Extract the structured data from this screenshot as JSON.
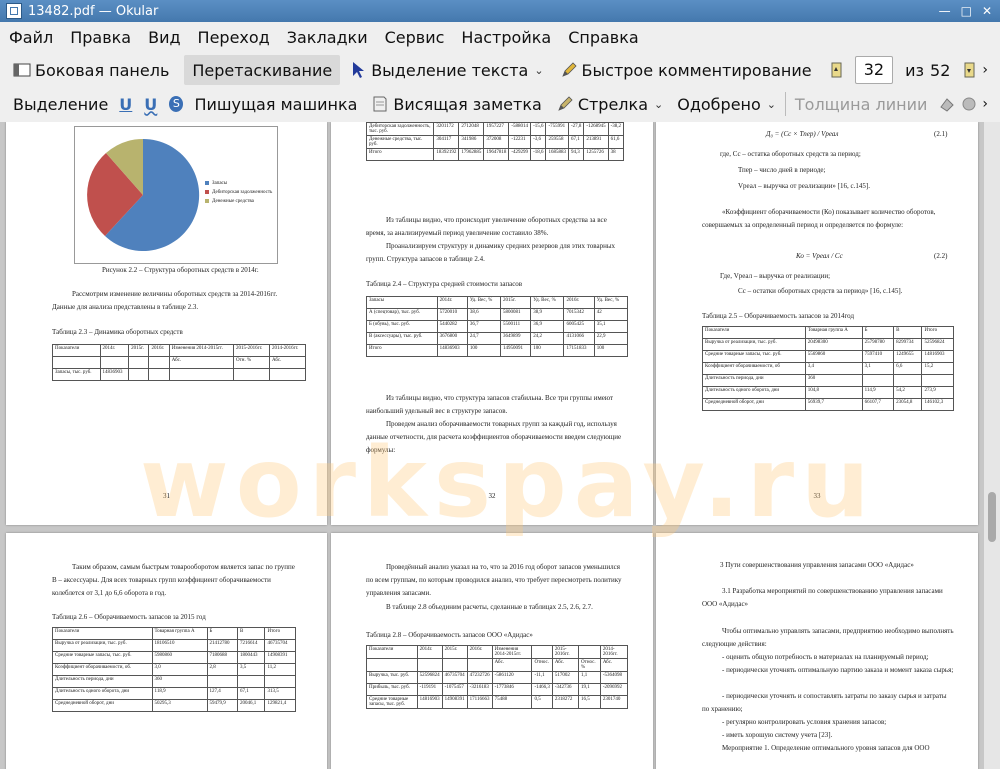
{
  "window": {
    "title": "13482.pdf — Okular"
  },
  "menu": [
    "Файл",
    "Правка",
    "Вид",
    "Переход",
    "Закладки",
    "Сервис",
    "Настройка",
    "Справка"
  ],
  "toolbar1": {
    "sidebar": "Боковая панель",
    "drag": "Перетаскивание",
    "text_select": "Выделение текста",
    "quick_comment": "Быстрое комментирование",
    "page_current": "32",
    "of": "из",
    "page_total": "52"
  },
  "toolbar2": {
    "highlight": "Выделение",
    "typewriter": "Пишущая машинка",
    "popup_note": "Висящая заметка",
    "arrow": "Стрелка",
    "approved": "Одобрено",
    "line_width": "Толщина линии"
  },
  "colors": {
    "titlebar": "#4d82b8",
    "pie_blue": "#4f81bd",
    "pie_red": "#c0504d",
    "pie_olive": "#b8b36e"
  },
  "watermark": "workspay.ru",
  "p1": {
    "legend": [
      "Запасы",
      "Дебиторская задолженность",
      "Денежные средства"
    ],
    "caption": "Рисунок 2.2 – Структура оборотных средств в 2014г.",
    "para": "Рассмотрим изменение величины оборотных средств за 2014-2016гг. Данные для анализа представлены в таблице 2.3.",
    "table_title": "Таблица 2.3 – Динамика оборотных средств",
    "table": [
      [
        "Показатели",
        "2014г.",
        "2015г.",
        "2016г.",
        "Изменения 2014-2015гг.",
        "2015-2016гг.",
        "2014-2016гг."
      ],
      [
        "",
        "",
        "",
        "",
        "Абс.",
        "Отн. %",
        "Абс."
      ],
      [
        "Запасы, тыс. руб.",
        "14836903",
        "",
        "",
        "",
        "",
        ""
      ]
    ],
    "page_num": "31"
  },
  "p2": {
    "top_table": [
      [
        "Дебиторская задолженность, тыс. руб.",
        "3201172",
        "2712048",
        "1957227",
        "-588014",
        "-15,6",
        "-755991",
        "-27,8",
        "-1268945",
        "-38,2"
      ],
      [
        "Денежные средства, тыс. руб.",
        "304117",
        "341986",
        "372008",
        "-12231",
        "-3,6",
        "259558",
        "67,1",
        "213891",
        "61,6"
      ],
      [
        "Итого",
        "18392192",
        "17962885",
        "19647818",
        "-429299",
        "-18,6",
        "1685883",
        "94,3",
        "1255726",
        "38"
      ]
    ],
    "para1": "Из таблицы видно, что происходит увеличение оборотных средства за все время, за анализируемый период увеличение составило 38%.",
    "para2": "Проанализируем структуру и динамику средних резервов для этих товарных групп. Структура запасов в таблице 2.4.",
    "table_title": "Таблица 2.4 – Структура средней стоимости запасов",
    "table": [
      [
        "Запасы",
        "2014г.",
        "Уд. Вес, %",
        "2015г.",
        "Уд. Вес, %",
        "2016г.",
        "Уд. Вес, %"
      ],
      [
        "А (спецтовар), тыс. руб.",
        "5720010",
        "38,6",
        "5800081",
        "38,9",
        "7015342",
        "42"
      ],
      [
        "Б (обувь), тыс. руб.",
        "5440282",
        "36,7",
        "5500111",
        "36,9",
        "6005425",
        "35,1"
      ],
      [
        "В (аксессуары), тыс. руб.",
        "3676800",
        "24,7",
        "3649899",
        "24,2",
        "4131066",
        "22,9"
      ],
      [
        "Итого",
        "14836903",
        "100",
        "14950091",
        "100",
        "17151833",
        "100"
      ]
    ],
    "para3": "Из таблицы видно, что структура запасов стабильна. Все три группы имеют наибольший удельный вес в структуре запасов.",
    "para4": "Проведем анализ оборачиваемости товарных групп за каждый год, используя данные отчетности, для расчета коэффициентов оборачиваемости введем следующие формулы:",
    "page_num": "32"
  },
  "p3": {
    "formula1": "Д₀ = (Сс × Тпер) / Vреал",
    "num1": "(2.1)",
    "def1": "где, Сс – остатка оборотных средств за период;",
    "def2": "Тпер – число дней в периоде;",
    "def3": "Vреал – выручка от реализации» [16, с.145].",
    "para1": "«Коэффициент оборачиваемости (Ко) показывает количество оборотов, совершаемых за определенный период и определяется по формуле:",
    "formula2": "Ко = Vреал / Сс",
    "num2": "(2.2)",
    "def4": "Где, Vреал – выручка от реализации;",
    "def5": "Сс – остатки оборотных средств за период» [16, с.145].",
    "table_title": "Таблица 2.5 – Оборачиваемость запасов за 2014год",
    "table": [
      [
        "Показатели",
        "Товарная группа А",
        "Б",
        "В",
        "Итого"
      ],
      [
        "Выручка от реализации, тыс. руб.",
        "20498300",
        "25798780",
        "8299734",
        "52596824"
      ],
      [
        "Средние товарные запасы, тыс. руб.",
        "5569860",
        "7597410",
        "1249655",
        "14816903"
      ],
      [
        "Коэффициент оборачиваемости, об",
        "3,4",
        "3,1",
        "6,6",
        "15,2"
      ],
      [
        "Длительность периода, дни",
        "360",
        "",
        "",
        ""
      ],
      [
        "Длительность одного оборота, дни",
        "104,8",
        "114,9",
        "54,2",
        "273,9"
      ],
      [
        "Среднедневной оборот, дни",
        "56939,7",
        "66107,7",
        "23054,8",
        "146102,3"
      ]
    ],
    "page_num": "33"
  },
  "p4": {
    "para": "Таким образом, самым быстрым товарооборотом является запас по группе В – аксессуары. Для всех товарных групп коэффициент оборачиваемости колеблется от 3,1 до 6,6 оборота в год.",
    "table_title": "Таблица 2.6 – Оборачиваемость запасов за 2015 год",
    "table": [
      [
        "Показатели",
        "Товарная группа А",
        "Б",
        "В",
        "Итого"
      ],
      [
        "Выручка от реализации, тыс. руб.",
        "18106510",
        "21412780",
        "7216614",
        "46735704"
      ],
      [
        "Средние товарные запасы, тыс. руб.",
        "5980860",
        "7180688",
        "1800443",
        "14908391"
      ],
      [
        "Коэффициент оборачиваемости, об.",
        "3,0",
        "2,8",
        "3,5",
        "11,2"
      ],
      [
        "Длительность периода, дни",
        "360",
        "",
        "",
        ""
      ],
      [
        "Длительность одного оборота, дни",
        "118,9",
        "127,4",
        "67,1",
        "313,5"
      ],
      [
        "Среднедневной оборот, дни",
        "50295,3",
        "59479,9",
        "20046,1",
        "129821,4"
      ]
    ]
  },
  "p5": {
    "para1": "Проведённый анализ указал на то, что за 2016 год оборот запасов уменьшился по всем группам, по которым проводился анализ, что требует пересмотреть политику управления запасами.",
    "para2": "В таблице 2.8 объединим расчеты, сделанные в таблицах 2.5, 2.6, 2.7.",
    "table_title": "Таблица 2.8 – Оборачиваемость запасов ООО «Адидас»",
    "table": [
      [
        "Показатели",
        "2014г.",
        "2015г.",
        "2016г.",
        "Изменения 2014-2015гг.",
        "",
        "2015-2016гг.",
        "",
        "2014-2016гг."
      ],
      [
        "",
        "",
        "",
        "",
        "Абс.",
        "Относ.",
        "Абс.",
        "Относ. %",
        "Абс."
      ],
      [
        "Выручка, тыс. руб.",
        "52596824",
        "46735704",
        "47232726",
        "-5861120",
        "-11,1",
        "517002",
        "1,1",
        "-5364098",
        "-10,1"
      ],
      [
        "Прибыль, тыс. руб.",
        "-119191",
        "-1075457",
        "-3216183",
        "-1773846",
        "-1466,3",
        "-342736",
        "19,1",
        "-2096992",
        "1753,1"
      ],
      [
        "Средние товарные запасы, тыс. руб.",
        "14816903",
        "14908391",
        "17116663",
        "75488",
        "0,5",
        "2318272",
        "16,5",
        "2301740",
        "15,5"
      ]
    ]
  },
  "p6": {
    "heading": "3 Пути совершенствования управления запасами ООО «Адидас»",
    "sub": "3.1 Разработка мероприятий по совершенствованию управления запасами ООО «Адидас»",
    "para1": "Чтобы оптимально управлять запасами, предприятию необходимо выполнять следующие действия:",
    "items": [
      "- оценить общую потребность в материалах на планируемый период;",
      "- периодически уточнять оптимальную партию заказа и момент заказа сырья;",
      "- периодически уточнять и сопоставлять затраты по заказу сырья и затраты по хранению;",
      "- регулярно контролировать условия хранения запасов;",
      "- иметь хорошую систему учета [23]."
    ],
    "para2": "Мероприятие 1. Определение оптимального уровня запасов для ООО"
  }
}
